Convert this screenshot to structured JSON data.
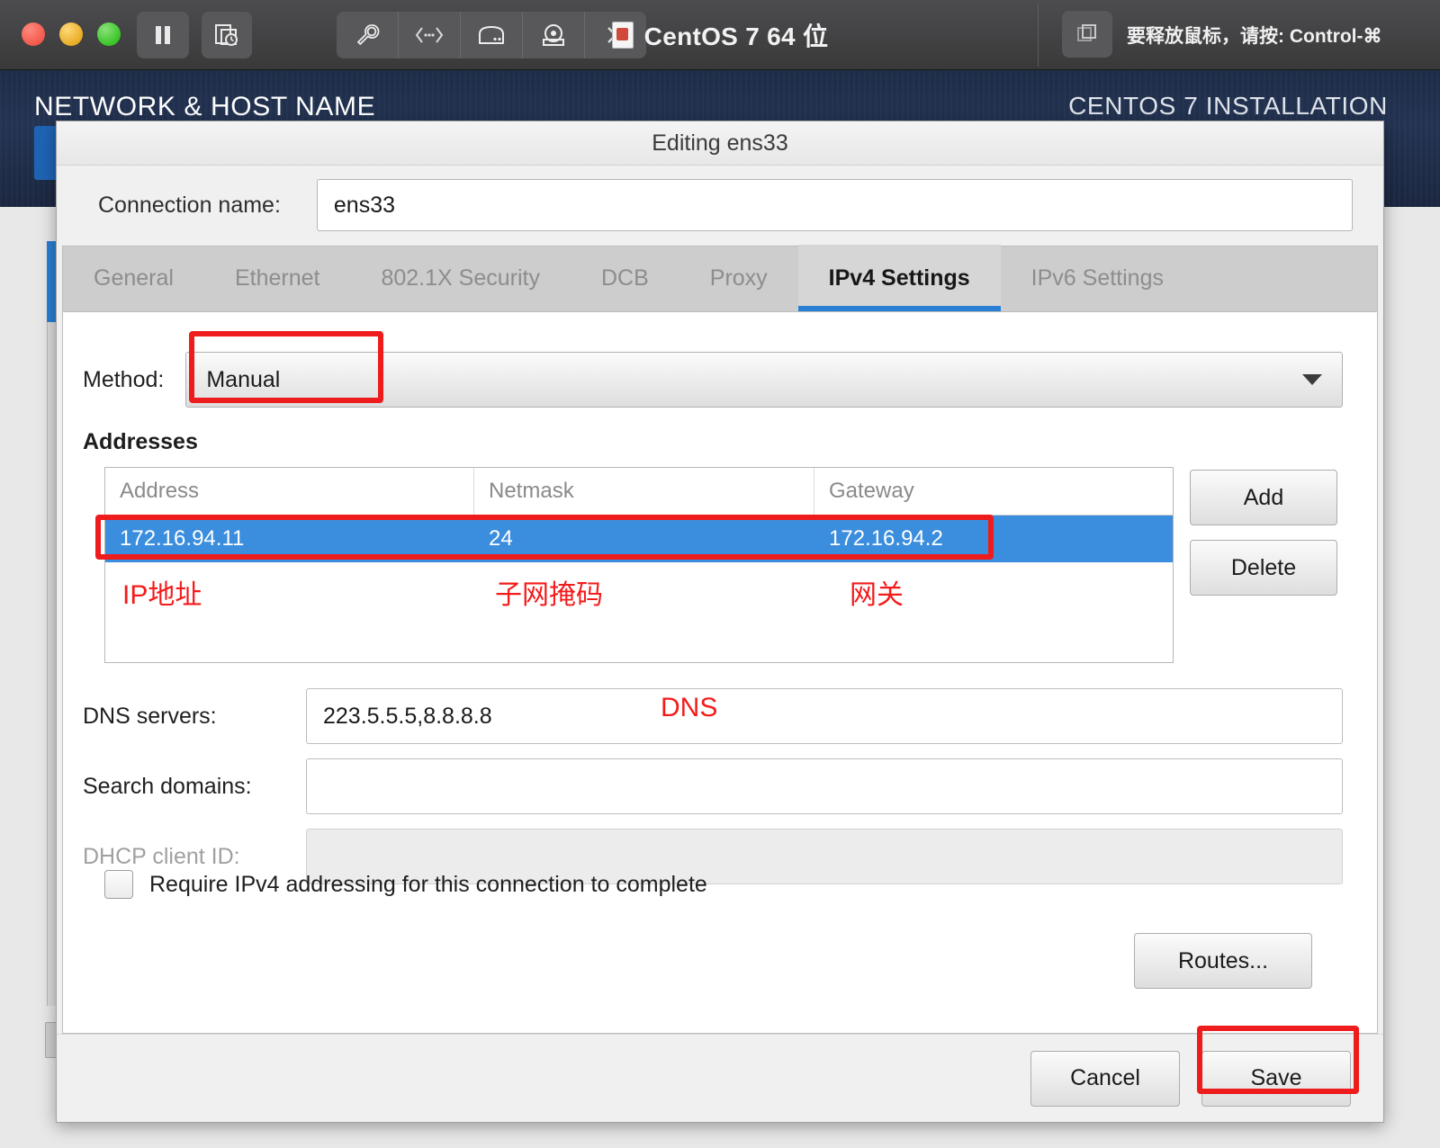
{
  "vm_titlebar": {
    "title": "CentOS 7 64 位",
    "release_hint": "要释放鼠标，请按: Control-⌘",
    "buttons": {
      "pause": "pause-button",
      "snapshot": "snapshot-button",
      "settings": "settings-button",
      "network": "network-button",
      "harddisk": "harddisk-button",
      "camera": "camera-button",
      "more": "more-button",
      "fullscreen": "fullscreen-button"
    }
  },
  "installer": {
    "page_title": "NETWORK & HOST NAME",
    "brand_right": "CENTOS 7 INSTALLATION"
  },
  "dialog": {
    "title": "Editing ens33",
    "connection_name_label": "Connection name:",
    "connection_name_value": "ens33",
    "tabs": [
      {
        "label": "General",
        "active": false
      },
      {
        "label": "Ethernet",
        "active": false
      },
      {
        "label": "802.1X Security",
        "active": false
      },
      {
        "label": "DCB",
        "active": false
      },
      {
        "label": "Proxy",
        "active": false
      },
      {
        "label": "IPv4 Settings",
        "active": true
      },
      {
        "label": "IPv6 Settings",
        "active": false
      }
    ],
    "method": {
      "label": "Method:",
      "value": "Manual"
    },
    "addresses": {
      "section_label": "Addresses",
      "columns": [
        "Address",
        "Netmask",
        "Gateway"
      ],
      "rows": [
        {
          "address": "172.16.94.11",
          "netmask": "24",
          "gateway": "172.16.94.2",
          "selected": true
        }
      ],
      "add_label": "Add",
      "delete_label": "Delete"
    },
    "dns": {
      "label": "DNS servers:",
      "value": "223.5.5.5,8.8.8.8"
    },
    "search_domains": {
      "label": "Search domains:",
      "value": ""
    },
    "dhcp_client_id": {
      "label": "DHCP client ID:",
      "value": ""
    },
    "require_ipv4": {
      "label": "Require IPv4 addressing for this connection to complete",
      "checked": false
    },
    "routes_label": "Routes...",
    "cancel_label": "Cancel",
    "save_label": "Save"
  },
  "annotations": {
    "color": "#f41b1b",
    "ip": "IP地址",
    "netmask": "子网掩码",
    "gateway": "网关",
    "dns": "DNS"
  },
  "colors": {
    "accent_blue": "#2a7fd4",
    "row_selected": "#3b8ddd",
    "annotation_red": "#ee1c1c",
    "header_navy": "#233352"
  }
}
